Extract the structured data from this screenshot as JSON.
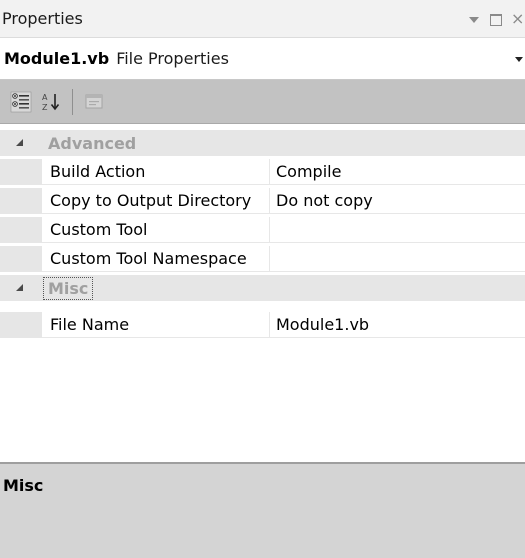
{
  "window": {
    "title": "Properties",
    "controls": [
      "dropdown-icon",
      "maximize-icon",
      "close-icon"
    ]
  },
  "object_selector": {
    "name": "Module1.vb",
    "type": "File Properties"
  },
  "toolbar": {
    "buttons": [
      {
        "name": "categorized-button",
        "icon": "categorized-icon",
        "enabled": true
      },
      {
        "name": "alphabetical-button",
        "icon": "sort-alphabetical-icon",
        "enabled": true
      },
      {
        "name": "property-pages-button",
        "icon": "property-pages-icon",
        "enabled": false
      }
    ]
  },
  "grid": {
    "categories": [
      {
        "label": "Advanced",
        "expanded": true,
        "properties": [
          {
            "name": "Build Action",
            "value": "Compile"
          },
          {
            "name": "Copy to Output Directory",
            "value": "Do not copy"
          },
          {
            "name": "Custom Tool",
            "value": ""
          },
          {
            "name": "Custom Tool Namespace",
            "value": ""
          }
        ]
      },
      {
        "label": "Misc",
        "expanded": true,
        "selected": true,
        "properties": [
          {
            "name": "File Name",
            "value": "Module1.vb"
          }
        ]
      }
    ]
  },
  "description": {
    "title": "Misc",
    "text": ""
  },
  "colors": {
    "toolbar_bg": "#c2c2c2",
    "gutter_bg": "#e6e6e6",
    "category_text": "#a0a0a0",
    "description_bg": "#d4d4d4"
  }
}
